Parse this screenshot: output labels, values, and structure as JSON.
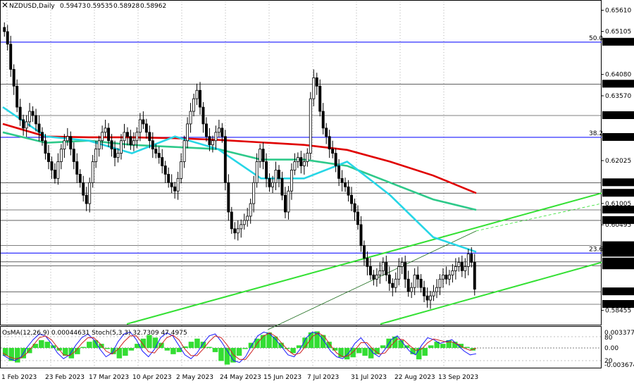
{
  "header": {
    "symbol": "NZDUSD,Daily",
    "open": "0.59473",
    "high": "0.59535",
    "low": "0.58928",
    "close": "0.58962"
  },
  "colors": {
    "up": "#000000",
    "down": "#000000",
    "ema_long": "#e00000",
    "ema_mid": "#2ec98a",
    "ema_short": "#27d6e6",
    "channel": "#33e033",
    "fib": "#1a1aff",
    "hline": "#000000",
    "osma": "#33dd33",
    "stoch_main": "#1a1aff",
    "stoch_signal": "#d02020",
    "grid": "#7f7f7f"
  },
  "chart_data": [
    {
      "type": "candlestick",
      "ylim": [
        0.5813,
        0.6582
      ],
      "price_ticks": [
        "0.65610",
        "0.65105",
        "0.64080",
        "0.63570",
        "0.62025",
        "0.61005",
        "0.60495",
        "0.58455"
      ],
      "levels": [
        {
          "value": 0.6485,
          "label": "0.64850",
          "fib": "50.0"
        },
        {
          "value": 0.6385,
          "label": "0.63850"
        },
        {
          "value": 0.631,
          "label": "0.63100"
        },
        {
          "value": 0.6258,
          "label": "0.62580",
          "fib": "38.2"
        },
        {
          "value": 0.615,
          "label": "0.61500"
        },
        {
          "value": 0.6125,
          "label": "0.61250"
        },
        {
          "value": 0.6085,
          "label": "0.60850"
        },
        {
          "value": 0.606,
          "label": "0.60600"
        },
        {
          "value": 0.6,
          "label": "0.60000"
        },
        {
          "value": 0.5982,
          "label": "0.59820",
          "fib": "23.6"
        },
        {
          "value": 0.5961,
          "label": "0.59610"
        },
        {
          "value": 0.5952,
          "label": "0.59520"
        },
        {
          "value": 0.589,
          "label": "0.58900"
        },
        {
          "value": 0.586,
          "label": "0.58600"
        }
      ],
      "date_labels": [
        "1 Feb 2023",
        "23 Feb 2023",
        "17 Mar 2023",
        "10 Apr 2023",
        "2 May 2023",
        "24 May 2023",
        "15 Jun 2023",
        "7 Jul 2023",
        "31 Jul 2023",
        "22 Aug 2023",
        "13 Sep 2023"
      ],
      "closes": [
        0.651,
        0.648,
        0.642,
        0.638,
        0.633,
        0.63,
        0.628,
        0.6295,
        0.632,
        0.631,
        0.629,
        0.627,
        0.625,
        0.622,
        0.62,
        0.618,
        0.616,
        0.62,
        0.623,
        0.625,
        0.626,
        0.623,
        0.62,
        0.617,
        0.615,
        0.612,
        0.61,
        0.615,
        0.62,
        0.623,
        0.625,
        0.627,
        0.628,
        0.625,
        0.623,
        0.621,
        0.622,
        0.625,
        0.627,
        0.626,
        0.624,
        0.625,
        0.627,
        0.63,
        0.629,
        0.627,
        0.625,
        0.623,
        0.622,
        0.621,
        0.619,
        0.617,
        0.615,
        0.614,
        0.613,
        0.616,
        0.62,
        0.625,
        0.629,
        0.632,
        0.635,
        0.637,
        0.633,
        0.629,
        0.626,
        0.624,
        0.625,
        0.627,
        0.628,
        0.626,
        0.615,
        0.608,
        0.604,
        0.603,
        0.604,
        0.605,
        0.606,
        0.607,
        0.61,
        0.615,
        0.62,
        0.623,
        0.62,
        0.616,
        0.614,
        0.615,
        0.618,
        0.616,
        0.612,
        0.608,
        0.613,
        0.618,
        0.62,
        0.621,
        0.619,
        0.62,
        0.622,
        0.635,
        0.64,
        0.638,
        0.632,
        0.628,
        0.626,
        0.623,
        0.622,
        0.619,
        0.616,
        0.615,
        0.614,
        0.612,
        0.61,
        0.608,
        0.605,
        0.6,
        0.597,
        0.595,
        0.593,
        0.592,
        0.593,
        0.594,
        0.596,
        0.593,
        0.591,
        0.59,
        0.592,
        0.595,
        0.596,
        0.592,
        0.589,
        0.59,
        0.593,
        0.592,
        0.59,
        0.588,
        0.587,
        0.588,
        0.589,
        0.59,
        0.592,
        0.593,
        0.592,
        0.593,
        0.594,
        0.595,
        0.596,
        0.594,
        0.595,
        0.598,
        0.596,
        0.5896
      ],
      "ema_long": [
        0.629,
        0.626,
        0.6258,
        0.6258,
        0.6256,
        0.6252,
        0.6246,
        0.624,
        0.6228,
        0.62,
        0.6167,
        0.6125
      ],
      "ema_mid": [
        0.627,
        0.6245,
        0.625,
        0.624,
        0.6235,
        0.623,
        0.6205,
        0.6205,
        0.619,
        0.615,
        0.611,
        0.6085
      ],
      "ema_short": [
        0.633,
        0.626,
        0.625,
        0.622,
        0.626,
        0.623,
        0.616,
        0.616,
        0.62,
        0.612,
        0.602,
        0.5985
      ],
      "channel_upper": [
        [
          0.5813,
          0.6125
        ],
        [
          0.59,
          0.606
        ]
      ],
      "channel_lower": [
        [
          0.5813,
          0.59
        ]
      ],
      "indicator": {
        "title": "OsMA(12,26,9) 0.00044631 Stoch(5,3,3) 32.7309 47.4975",
        "osma_max": "0.0033779",
        "osma_zero": "0.00",
        "osma_min": "-0.0036749",
        "stoch_levels": [
          "80",
          "20"
        ],
        "osma": [
          -0.0015,
          -0.0025,
          -0.0028,
          -0.002,
          -0.001,
          0.0008,
          0.0015,
          0.0012,
          0.0005,
          -0.0005,
          -0.0015,
          -0.002,
          -0.0012,
          0.0002,
          0.0012,
          0.0015,
          0.0008,
          -0.0002,
          -0.0012,
          -0.002,
          -0.0015,
          -0.0005,
          0.0008,
          0.0018,
          0.0025,
          0.002,
          0.001,
          -0.0005,
          -0.0012,
          -0.0008,
          0.0003,
          0.0012,
          0.0018,
          0.0012,
          0.0002,
          -0.0008,
          -0.0025,
          -0.0032,
          -0.0028,
          -0.0015,
          -0.0002,
          0.001,
          0.0018,
          0.0025,
          0.003,
          0.0022,
          0.001,
          -0.0002,
          -0.001,
          0.0005,
          0.002,
          0.003,
          0.0032,
          0.0025,
          0.0012,
          -0.0005,
          -0.0018,
          -0.0022,
          -0.0018,
          -0.001,
          -0.0015,
          -0.002,
          -0.0012,
          0.0005,
          0.0018,
          0.0022,
          0.0015,
          0.0005,
          -0.0012,
          -0.0022,
          -0.0015,
          0.0005,
          0.0012,
          0.0008,
          0.0015,
          0.0012,
          0.0008,
          0.0002,
          -0.0005
        ],
        "stoch_k": [
          30,
          20,
          15,
          25,
          50,
          70,
          85,
          80,
          60,
          35,
          20,
          30,
          55,
          75,
          85,
          70,
          45,
          25,
          35,
          65,
          85,
          90,
          70,
          40,
          25,
          45,
          75,
          88,
          80,
          55,
          30,
          20,
          35,
          60,
          80,
          85,
          65,
          40,
          15,
          10,
          25,
          55,
          80,
          90,
          85,
          70,
          50,
          30,
          25,
          45,
          75,
          90,
          85,
          65,
          40,
          25,
          20,
          35,
          60,
          75,
          55,
          35,
          25,
          45,
          70,
          80,
          60,
          40,
          30,
          55,
          75,
          70,
          60,
          65,
          70,
          55,
          40,
          30,
          33
        ],
        "stoch_d": [
          35,
          25,
          20,
          22,
          35,
          55,
          75,
          80,
          70,
          50,
          30,
          28,
          40,
          60,
          75,
          75,
          60,
          40,
          32,
          45,
          65,
          80,
          80,
          60,
          38,
          35,
          55,
          75,
          82,
          70,
          45,
          28,
          28,
          45,
          65,
          80,
          75,
          55,
          30,
          18,
          18,
          38,
          62,
          80,
          88,
          78,
          60,
          42,
          30,
          35,
          55,
          78,
          88,
          78,
          55,
          35,
          25,
          28,
          42,
          62,
          62,
          45,
          32,
          35,
          55,
          72,
          70,
          55,
          42,
          45,
          62,
          72,
          68,
          64,
          64,
          58,
          48,
          42,
          47.5
        ]
      }
    }
  ]
}
